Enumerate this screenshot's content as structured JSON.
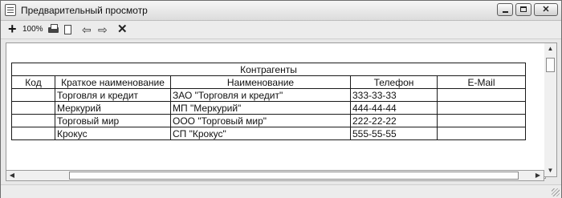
{
  "window": {
    "title": "Предварительный просмотр"
  },
  "toolbar": {
    "zoom_label": "100%"
  },
  "report": {
    "caption": "Контрагенты",
    "columns": [
      "Код",
      "Краткое наименование",
      "Наименование",
      "Телефон",
      "E-Mail"
    ],
    "rows": [
      [
        "",
        "Торговля и кредит",
        "ЗАО \"Торговля и кредит\"",
        "333-33-33",
        ""
      ],
      [
        "",
        "Меркурий",
        "МП \"Меркурий\"",
        "444-44-44",
        ""
      ],
      [
        "",
        "Торговый мир",
        "ООО \"Торговый мир\"",
        "222-22-22",
        ""
      ],
      [
        "",
        "Крокус",
        "СП \"Крокус\"",
        "555-55-55",
        ""
      ]
    ]
  },
  "icons": {
    "app": "document-icon",
    "zoom": "plus-icon",
    "print": "printer-icon",
    "page": "page-icon",
    "prev": "arrow-left-icon",
    "next": "arrow-right-icon",
    "close": "close-icon"
  }
}
